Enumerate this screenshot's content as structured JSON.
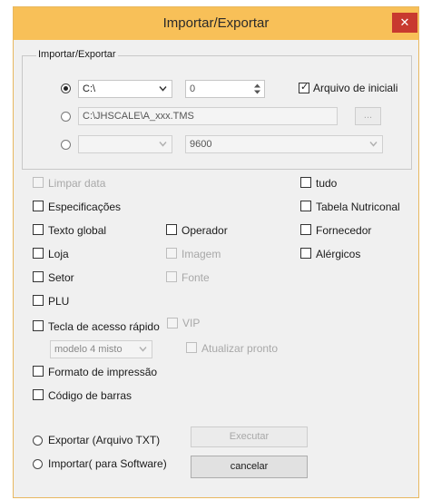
{
  "window": {
    "title": "Importar/Exportar",
    "close_icon": "close-icon"
  },
  "import_export_group": {
    "label": "Importar/Exportar",
    "row1": {
      "port_value": "C:\\",
      "number_value": "0",
      "checkbox_label": "Arquivo de iniciali",
      "checkbox_checked": true
    },
    "row2": {
      "path_value": "C:\\JHSCALE\\A_xxx.TMS",
      "browse_label": "..."
    },
    "row3": {
      "port_value": "",
      "baud_value": "9600"
    }
  },
  "options": {
    "limpar_data": "Limpar data",
    "tudo": "tudo",
    "especificacoes": "Especificações",
    "tabela_nutricional": "Tabela Nutriconal",
    "texto_global": "Texto global",
    "operador": "Operador",
    "fornecedor": "Fornecedor",
    "loja": "Loja",
    "imagem": "Imagem",
    "alergicos": "Alérgicos",
    "setor": "Setor",
    "fonte": "Fonte",
    "plu": "PLU",
    "tecla_acesso": "Tecla de acesso rápido",
    "vip": "VIP",
    "modelo_value": "modelo 4 misto",
    "atualizar_pronto": "Atualizar pronto",
    "formato_impressao": "Formato de impressão",
    "codigo_barras": "Código de barras"
  },
  "actions": {
    "exportar_label": "Exportar (Arquivo TXT)",
    "importar_label": "Importar( para Software)",
    "executar_label": "Executar",
    "cancelar_label": "cancelar"
  }
}
